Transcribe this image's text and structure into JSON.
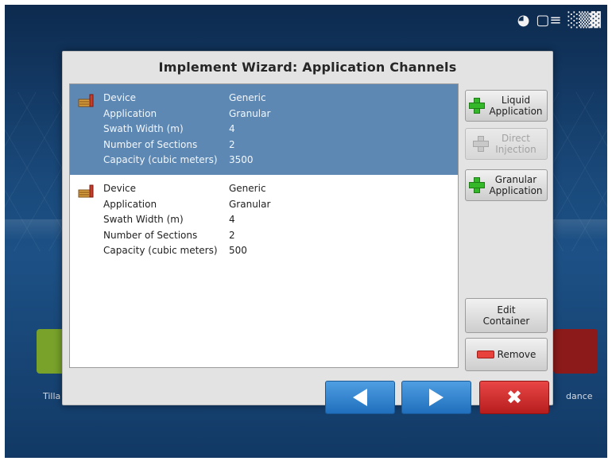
{
  "dialog": {
    "title": "Implement Wizard: Application Channels"
  },
  "channels": [
    {
      "selected": true,
      "rows": [
        {
          "key": "Device",
          "value": "Generic"
        },
        {
          "key": "Application",
          "value": "Granular"
        },
        {
          "key": "Swath Width (m)",
          "value": "4"
        },
        {
          "key": "Number of Sections",
          "value": "2"
        },
        {
          "key": "Capacity (cubic meters)",
          "value": "3500"
        }
      ]
    },
    {
      "selected": false,
      "rows": [
        {
          "key": "Device",
          "value": "Generic"
        },
        {
          "key": "Application",
          "value": "Granular"
        },
        {
          "key": "Swath Width (m)",
          "value": "4"
        },
        {
          "key": "Number of Sections",
          "value": "2"
        },
        {
          "key": "Capacity (cubic meters)",
          "value": "500"
        }
      ]
    }
  ],
  "side_buttons": {
    "liquid": "Liquid Application",
    "direct": "Direct Injection",
    "granular": "Granular Application",
    "edit": "Edit Container",
    "remove": "Remove"
  },
  "background": {
    "left_tile_label": "Tilla",
    "right_tile_label": "dance"
  },
  "icons": {
    "back": "back-arrow-icon",
    "next": "next-arrow-icon",
    "cancel": "close-icon"
  },
  "colors": {
    "selected_row": "#5d88b3",
    "nav_blue": "#2f7fcc",
    "cancel_red": "#d13232",
    "plus_green": "#34b82a"
  }
}
